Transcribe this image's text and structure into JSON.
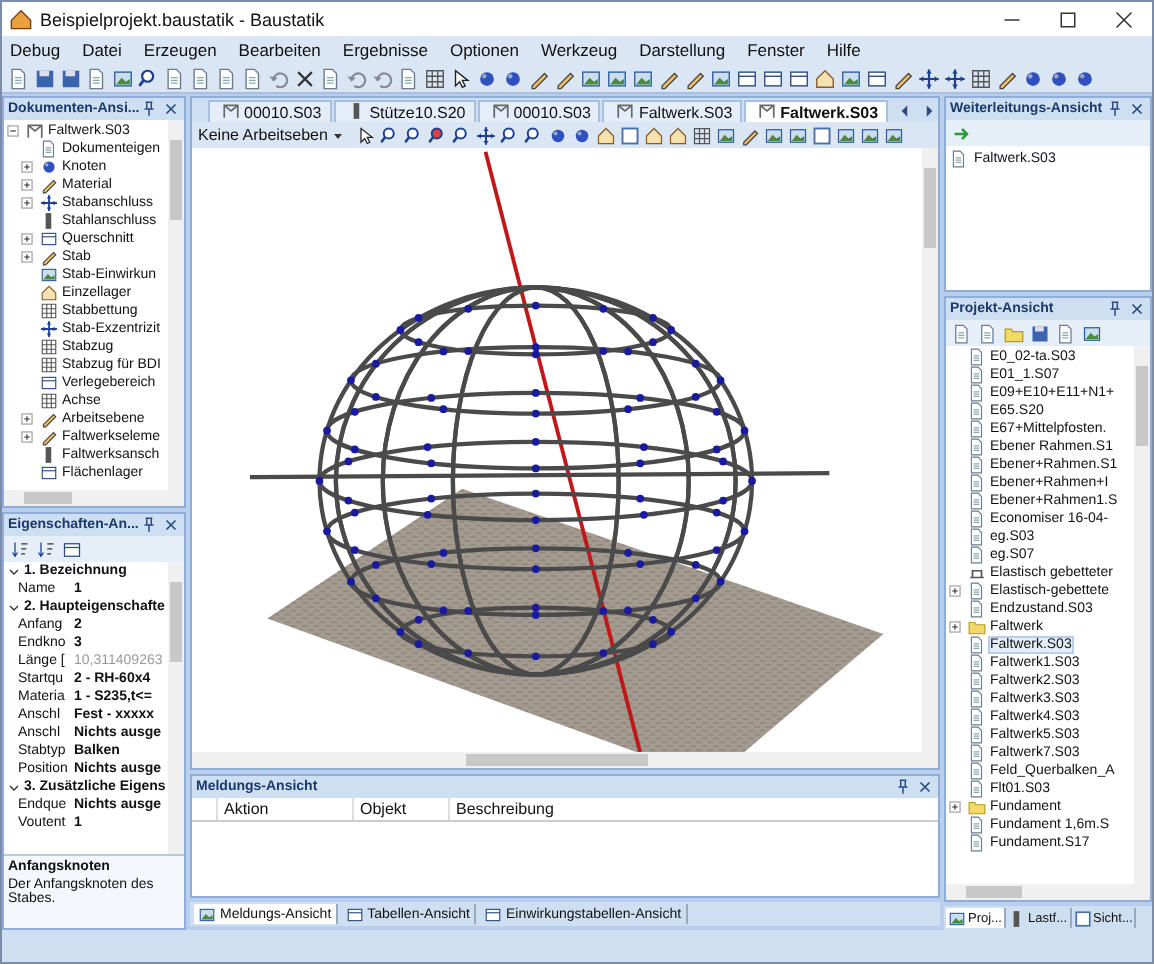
{
  "window": {
    "title": "Beispielprojekt.baustatik - Baustatik"
  },
  "menu": [
    "Debug",
    "Datei",
    "Erzeugen",
    "Bearbeiten",
    "Ergebnisse",
    "Optionen",
    "Werkzeug",
    "Darstellung",
    "Fenster",
    "Hilfe"
  ],
  "document_view": {
    "title": "Dokumenten-Ansi...",
    "tree": {
      "label": "Faltwerk.S03",
      "collapsed": false,
      "children": [
        {
          "label": "Dokumenteigen",
          "collapsed": false
        },
        {
          "label": "Knoten",
          "collapsed": true
        },
        {
          "label": "Material",
          "collapsed": true
        },
        {
          "label": "Stabanschluss",
          "collapsed": true
        },
        {
          "label": "Stahlanschluss",
          "collapsed": false
        },
        {
          "label": "Querschnitt",
          "collapsed": true
        },
        {
          "label": "Stab",
          "collapsed": true
        },
        {
          "label": "Stab-Einwirkun",
          "collapsed": false
        },
        {
          "label": "Einzellager",
          "collapsed": false
        },
        {
          "label": "Stabbettung",
          "collapsed": false
        },
        {
          "label": "Stab-Exzentrizit",
          "collapsed": false
        },
        {
          "label": "Stabzug",
          "collapsed": false
        },
        {
          "label": "Stabzug für BDI",
          "collapsed": false
        },
        {
          "label": "Verlegebereich",
          "collapsed": false
        },
        {
          "label": "Achse",
          "collapsed": false
        },
        {
          "label": "Arbeitsebene",
          "collapsed": true
        },
        {
          "label": "Faltwerkseleme",
          "collapsed": true
        },
        {
          "label": "Faltwerksansch",
          "collapsed": false
        },
        {
          "label": "Flächenlager",
          "collapsed": false
        }
      ]
    }
  },
  "properties": {
    "title": "Eigenschaften-An...",
    "groups": [
      {
        "label": "1. Bezeichnung",
        "expanded": true,
        "rows": [
          {
            "name": "Name",
            "value": "1",
            "disabled": false
          }
        ]
      },
      {
        "label": "2. Haupteigenschafte",
        "expanded": true,
        "rows": [
          {
            "name": "Anfang",
            "value": "2",
            "disabled": false
          },
          {
            "name": "Endkno",
            "value": "3",
            "disabled": false
          },
          {
            "name": "Länge [",
            "value": "10,311409263",
            "disabled": true
          },
          {
            "name": "Startqu",
            "value": "2 - RH-60x4",
            "disabled": false
          },
          {
            "name": "Materia",
            "value": "1 - S235,t<=",
            "disabled": false
          },
          {
            "name": "Anschl",
            "value": "Fest - xxxxx",
            "disabled": false
          },
          {
            "name": "Anschl",
            "value": "Nichts ausge",
            "disabled": false
          },
          {
            "name": "Stabtyp",
            "value": "Balken",
            "disabled": false
          },
          {
            "name": "Position",
            "value": "Nichts ausge",
            "disabled": false
          }
        ]
      },
      {
        "label": "3. Zusätzliche Eigens",
        "expanded": true,
        "rows": [
          {
            "name": "Endque",
            "value": "Nichts ausge",
            "disabled": false
          },
          {
            "name": "Voutent",
            "value": "1",
            "disabled": false
          }
        ]
      }
    ],
    "description": {
      "title": "Anfangsknoten",
      "text": "Der Anfangsknoten des Stabes."
    }
  },
  "doc_tabs": [
    {
      "label": "00010.S03",
      "selected": false
    },
    {
      "label": "Stütze10.S20",
      "selected": false
    },
    {
      "label": "00010.S03",
      "selected": false
    },
    {
      "label": "Faltwerk.S03",
      "selected": false
    },
    {
      "label": "Faltwerk.S03",
      "selected": true
    }
  ],
  "view_toolbar": {
    "workplane": "Keine Arbeitseben"
  },
  "messages": {
    "title": "Meldungs-Ansicht",
    "columns": [
      "Aktion",
      "Objekt",
      "Beschreibung"
    ]
  },
  "bottom_tabs": [
    {
      "label": "Meldungs-Ansicht",
      "selected": true
    },
    {
      "label": "Tabellen-Ansicht",
      "selected": false
    },
    {
      "label": "Einwirkungstabellen-Ansicht",
      "selected": false
    }
  ],
  "forwarding": {
    "title": "Weiterleitungs-Ansicht",
    "items": [
      "Faltwerk.S03"
    ]
  },
  "project": {
    "title": "Projekt-Ansicht",
    "items": [
      {
        "label": "E0_02-ta.S03",
        "kind": "file",
        "collapsed": false,
        "selected": false
      },
      {
        "label": "E01_1.S07",
        "kind": "file",
        "collapsed": false,
        "selected": false
      },
      {
        "label": "E09+E10+E11+N1+",
        "kind": "file",
        "collapsed": false,
        "selected": false
      },
      {
        "label": "E65.S20",
        "kind": "file",
        "collapsed": false,
        "selected": false
      },
      {
        "label": "E67+Mittelpfosten.",
        "kind": "file",
        "collapsed": false,
        "selected": false
      },
      {
        "label": "Ebener Rahmen.S1",
        "kind": "file",
        "collapsed": false,
        "selected": false
      },
      {
        "label": "Ebener+Rahmen.S1",
        "kind": "file",
        "collapsed": false,
        "selected": false
      },
      {
        "label": "Ebener+Rahmen+I",
        "kind": "file",
        "collapsed": false,
        "selected": false
      },
      {
        "label": "Ebener+Rahmen1.S",
        "kind": "file",
        "collapsed": false,
        "selected": false
      },
      {
        "label": "Economiser 16-04-",
        "kind": "file",
        "collapsed": false,
        "selected": false
      },
      {
        "label": "eg.S03",
        "kind": "file",
        "collapsed": false,
        "selected": false
      },
      {
        "label": "eg.S07",
        "kind": "file",
        "collapsed": false,
        "selected": false
      },
      {
        "label": "Elastisch gebetteter",
        "kind": "support",
        "collapsed": false,
        "selected": false
      },
      {
        "label": "Elastisch-gebettete",
        "kind": "file",
        "collapsed": true,
        "selected": false
      },
      {
        "label": "Endzustand.S03",
        "kind": "file",
        "collapsed": false,
        "selected": false
      },
      {
        "label": "Faltwerk",
        "kind": "folder",
        "collapsed": true,
        "selected": false
      },
      {
        "label": "Faltwerk.S03",
        "kind": "file",
        "collapsed": false,
        "selected": true
      },
      {
        "label": "Faltwerk1.S03",
        "kind": "file",
        "collapsed": false,
        "selected": false
      },
      {
        "label": "Faltwerk2.S03",
        "kind": "file",
        "collapsed": false,
        "selected": false
      },
      {
        "label": "Faltwerk3.S03",
        "kind": "file",
        "collapsed": false,
        "selected": false
      },
      {
        "label": "Faltwerk4.S03",
        "kind": "file",
        "collapsed": false,
        "selected": false
      },
      {
        "label": "Faltwerk5.S03",
        "kind": "file",
        "collapsed": false,
        "selected": false
      },
      {
        "label": "Faltwerk7.S03",
        "kind": "file",
        "collapsed": false,
        "selected": false
      },
      {
        "label": "Feld_Querbalken_A",
        "kind": "file",
        "collapsed": false,
        "selected": false
      },
      {
        "label": "Flt01.S03",
        "kind": "file",
        "collapsed": false,
        "selected": false
      },
      {
        "label": "Fundament",
        "kind": "folder",
        "collapsed": true,
        "selected": false
      },
      {
        "label": "Fundament 1,6m.S",
        "kind": "file",
        "collapsed": false,
        "selected": false
      },
      {
        "label": "Fundament.S17",
        "kind": "file",
        "collapsed": false,
        "selected": false
      }
    ]
  },
  "project_tabs": [
    {
      "label": "Proj...",
      "selected": true
    },
    {
      "label": "Lastf...",
      "selected": false
    },
    {
      "label": "Sicht...",
      "selected": false
    }
  ]
}
